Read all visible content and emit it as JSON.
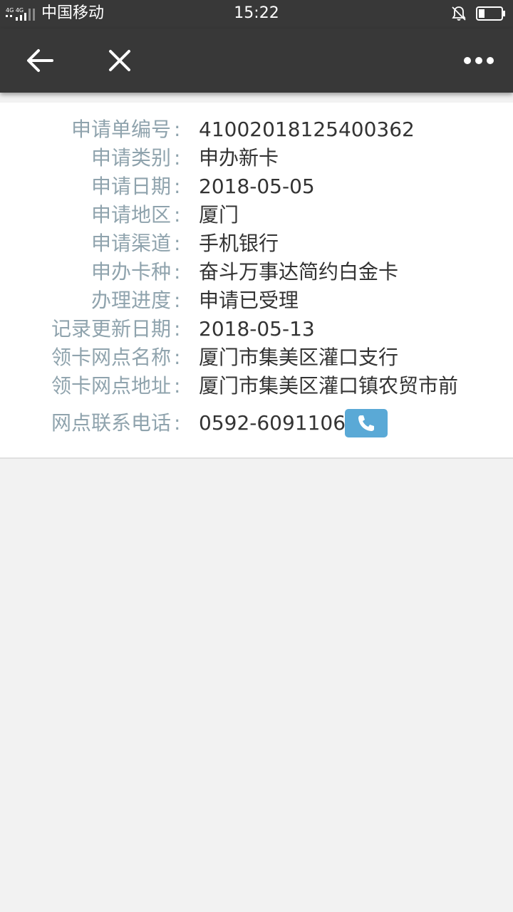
{
  "status_bar": {
    "network": "4G 4G",
    "carrier": "中国移动",
    "time": "15:22"
  },
  "nav": {
    "back_icon": "arrow-left-icon",
    "close_icon": "close-icon",
    "more_icon": "more-horizontal-icon"
  },
  "fields": [
    {
      "label": "申请单编号",
      "value": "41002018125400362"
    },
    {
      "label": "申请类别",
      "value": "申办新卡"
    },
    {
      "label": "申请日期",
      "value": "2018-05-05"
    },
    {
      "label": "申请地区",
      "value": "厦门"
    },
    {
      "label": "申请渠道",
      "value": "手机银行"
    },
    {
      "label": "申办卡种",
      "value": "奋斗万事达简约白金卡"
    },
    {
      "label": "办理进度",
      "value": "申请已受理"
    },
    {
      "label": "记录更新日期",
      "value": "2018-05-13"
    },
    {
      "label": "领卡网点名称",
      "value": "厦门市集美区灌口支行"
    },
    {
      "label": "领卡网点地址",
      "value": "厦门市集美区灌口镇农贸市前"
    },
    {
      "label": "网点联系电话",
      "value": "0592-6091106"
    }
  ],
  "colon": ":",
  "colors": {
    "bar": "#383838",
    "label": "#8fa3ad",
    "value": "#333333",
    "phone_button": "#5aa9d6",
    "background": "#f2f2f2"
  }
}
